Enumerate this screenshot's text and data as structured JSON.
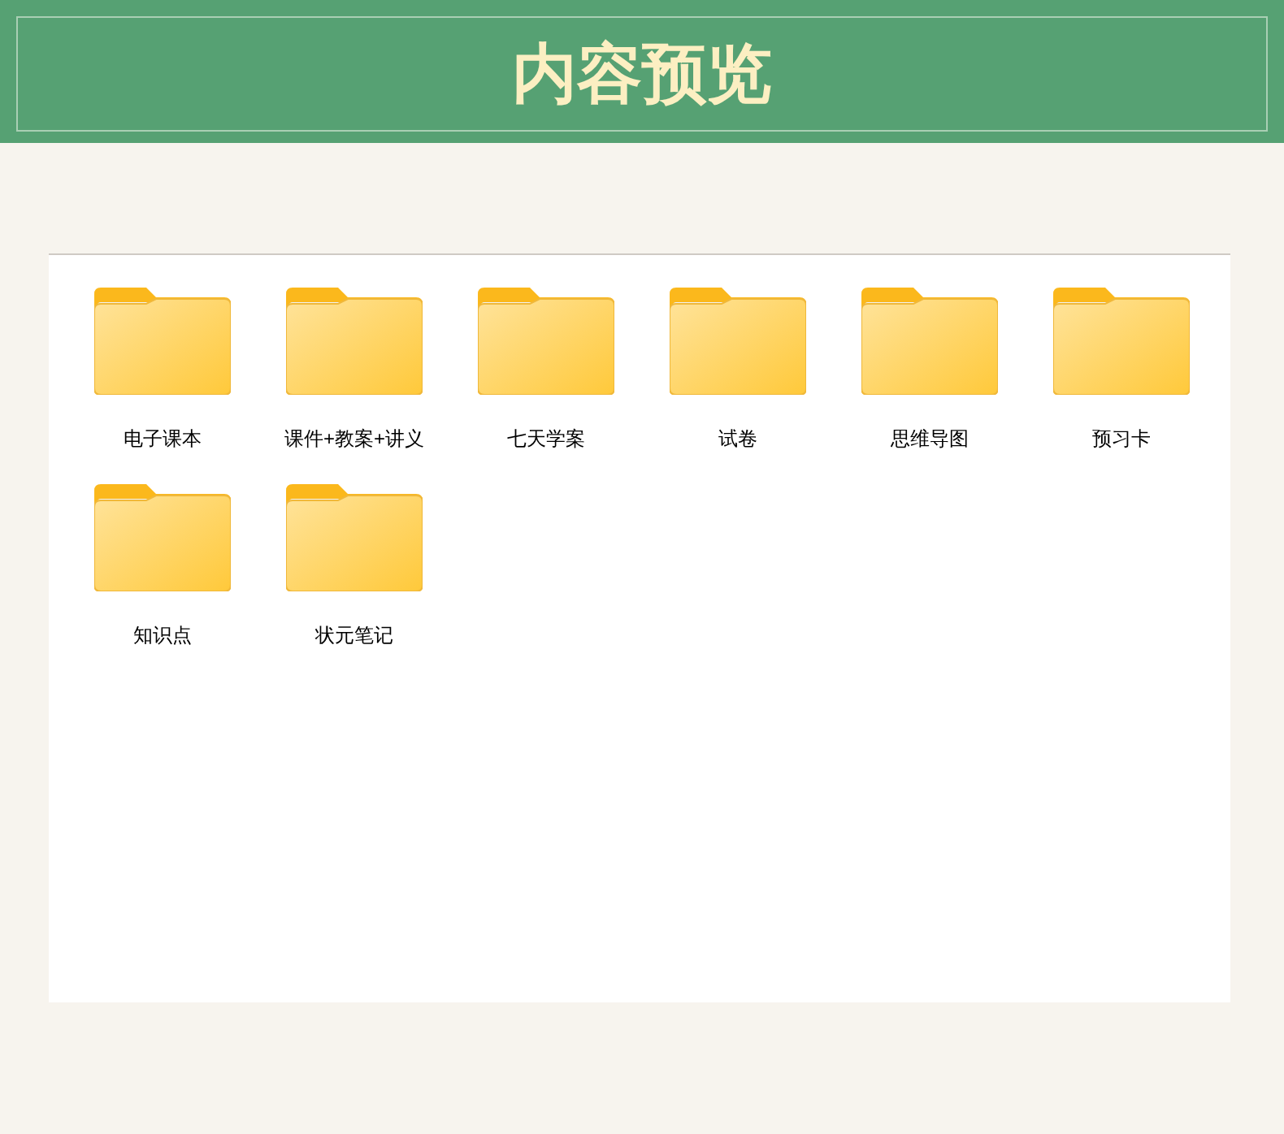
{
  "header": {
    "title": "内容预览"
  },
  "folders": [
    {
      "label": "电子课本"
    },
    {
      "label": "课件+教案+讲义"
    },
    {
      "label": "七天学案"
    },
    {
      "label": "试卷"
    },
    {
      "label": "思维导图"
    },
    {
      "label": "预习卡"
    },
    {
      "label": "知识点"
    },
    {
      "label": "状元笔记"
    }
  ]
}
